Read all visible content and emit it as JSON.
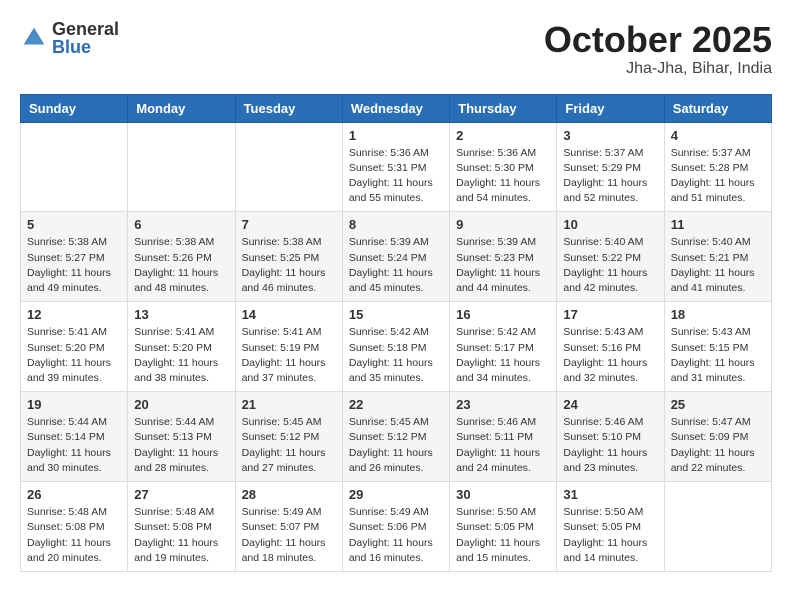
{
  "header": {
    "logo_general": "General",
    "logo_blue": "Blue",
    "month": "October 2025",
    "location": "Jha-Jha, Bihar, India"
  },
  "weekdays": [
    "Sunday",
    "Monday",
    "Tuesday",
    "Wednesday",
    "Thursday",
    "Friday",
    "Saturday"
  ],
  "weeks": [
    [
      {
        "day": "",
        "info": ""
      },
      {
        "day": "",
        "info": ""
      },
      {
        "day": "",
        "info": ""
      },
      {
        "day": "1",
        "info": "Sunrise: 5:36 AM\nSunset: 5:31 PM\nDaylight: 11 hours\nand 55 minutes."
      },
      {
        "day": "2",
        "info": "Sunrise: 5:36 AM\nSunset: 5:30 PM\nDaylight: 11 hours\nand 54 minutes."
      },
      {
        "day": "3",
        "info": "Sunrise: 5:37 AM\nSunset: 5:29 PM\nDaylight: 11 hours\nand 52 minutes."
      },
      {
        "day": "4",
        "info": "Sunrise: 5:37 AM\nSunset: 5:28 PM\nDaylight: 11 hours\nand 51 minutes."
      }
    ],
    [
      {
        "day": "5",
        "info": "Sunrise: 5:38 AM\nSunset: 5:27 PM\nDaylight: 11 hours\nand 49 minutes."
      },
      {
        "day": "6",
        "info": "Sunrise: 5:38 AM\nSunset: 5:26 PM\nDaylight: 11 hours\nand 48 minutes."
      },
      {
        "day": "7",
        "info": "Sunrise: 5:38 AM\nSunset: 5:25 PM\nDaylight: 11 hours\nand 46 minutes."
      },
      {
        "day": "8",
        "info": "Sunrise: 5:39 AM\nSunset: 5:24 PM\nDaylight: 11 hours\nand 45 minutes."
      },
      {
        "day": "9",
        "info": "Sunrise: 5:39 AM\nSunset: 5:23 PM\nDaylight: 11 hours\nand 44 minutes."
      },
      {
        "day": "10",
        "info": "Sunrise: 5:40 AM\nSunset: 5:22 PM\nDaylight: 11 hours\nand 42 minutes."
      },
      {
        "day": "11",
        "info": "Sunrise: 5:40 AM\nSunset: 5:21 PM\nDaylight: 11 hours\nand 41 minutes."
      }
    ],
    [
      {
        "day": "12",
        "info": "Sunrise: 5:41 AM\nSunset: 5:20 PM\nDaylight: 11 hours\nand 39 minutes."
      },
      {
        "day": "13",
        "info": "Sunrise: 5:41 AM\nSunset: 5:20 PM\nDaylight: 11 hours\nand 38 minutes."
      },
      {
        "day": "14",
        "info": "Sunrise: 5:41 AM\nSunset: 5:19 PM\nDaylight: 11 hours\nand 37 minutes."
      },
      {
        "day": "15",
        "info": "Sunrise: 5:42 AM\nSunset: 5:18 PM\nDaylight: 11 hours\nand 35 minutes."
      },
      {
        "day": "16",
        "info": "Sunrise: 5:42 AM\nSunset: 5:17 PM\nDaylight: 11 hours\nand 34 minutes."
      },
      {
        "day": "17",
        "info": "Sunrise: 5:43 AM\nSunset: 5:16 PM\nDaylight: 11 hours\nand 32 minutes."
      },
      {
        "day": "18",
        "info": "Sunrise: 5:43 AM\nSunset: 5:15 PM\nDaylight: 11 hours\nand 31 minutes."
      }
    ],
    [
      {
        "day": "19",
        "info": "Sunrise: 5:44 AM\nSunset: 5:14 PM\nDaylight: 11 hours\nand 30 minutes."
      },
      {
        "day": "20",
        "info": "Sunrise: 5:44 AM\nSunset: 5:13 PM\nDaylight: 11 hours\nand 28 minutes."
      },
      {
        "day": "21",
        "info": "Sunrise: 5:45 AM\nSunset: 5:12 PM\nDaylight: 11 hours\nand 27 minutes."
      },
      {
        "day": "22",
        "info": "Sunrise: 5:45 AM\nSunset: 5:12 PM\nDaylight: 11 hours\nand 26 minutes."
      },
      {
        "day": "23",
        "info": "Sunrise: 5:46 AM\nSunset: 5:11 PM\nDaylight: 11 hours\nand 24 minutes."
      },
      {
        "day": "24",
        "info": "Sunrise: 5:46 AM\nSunset: 5:10 PM\nDaylight: 11 hours\nand 23 minutes."
      },
      {
        "day": "25",
        "info": "Sunrise: 5:47 AM\nSunset: 5:09 PM\nDaylight: 11 hours\nand 22 minutes."
      }
    ],
    [
      {
        "day": "26",
        "info": "Sunrise: 5:48 AM\nSunset: 5:08 PM\nDaylight: 11 hours\nand 20 minutes."
      },
      {
        "day": "27",
        "info": "Sunrise: 5:48 AM\nSunset: 5:08 PM\nDaylight: 11 hours\nand 19 minutes."
      },
      {
        "day": "28",
        "info": "Sunrise: 5:49 AM\nSunset: 5:07 PM\nDaylight: 11 hours\nand 18 minutes."
      },
      {
        "day": "29",
        "info": "Sunrise: 5:49 AM\nSunset: 5:06 PM\nDaylight: 11 hours\nand 16 minutes."
      },
      {
        "day": "30",
        "info": "Sunrise: 5:50 AM\nSunset: 5:05 PM\nDaylight: 11 hours\nand 15 minutes."
      },
      {
        "day": "31",
        "info": "Sunrise: 5:50 AM\nSunset: 5:05 PM\nDaylight: 11 hours\nand 14 minutes."
      },
      {
        "day": "",
        "info": ""
      }
    ]
  ]
}
